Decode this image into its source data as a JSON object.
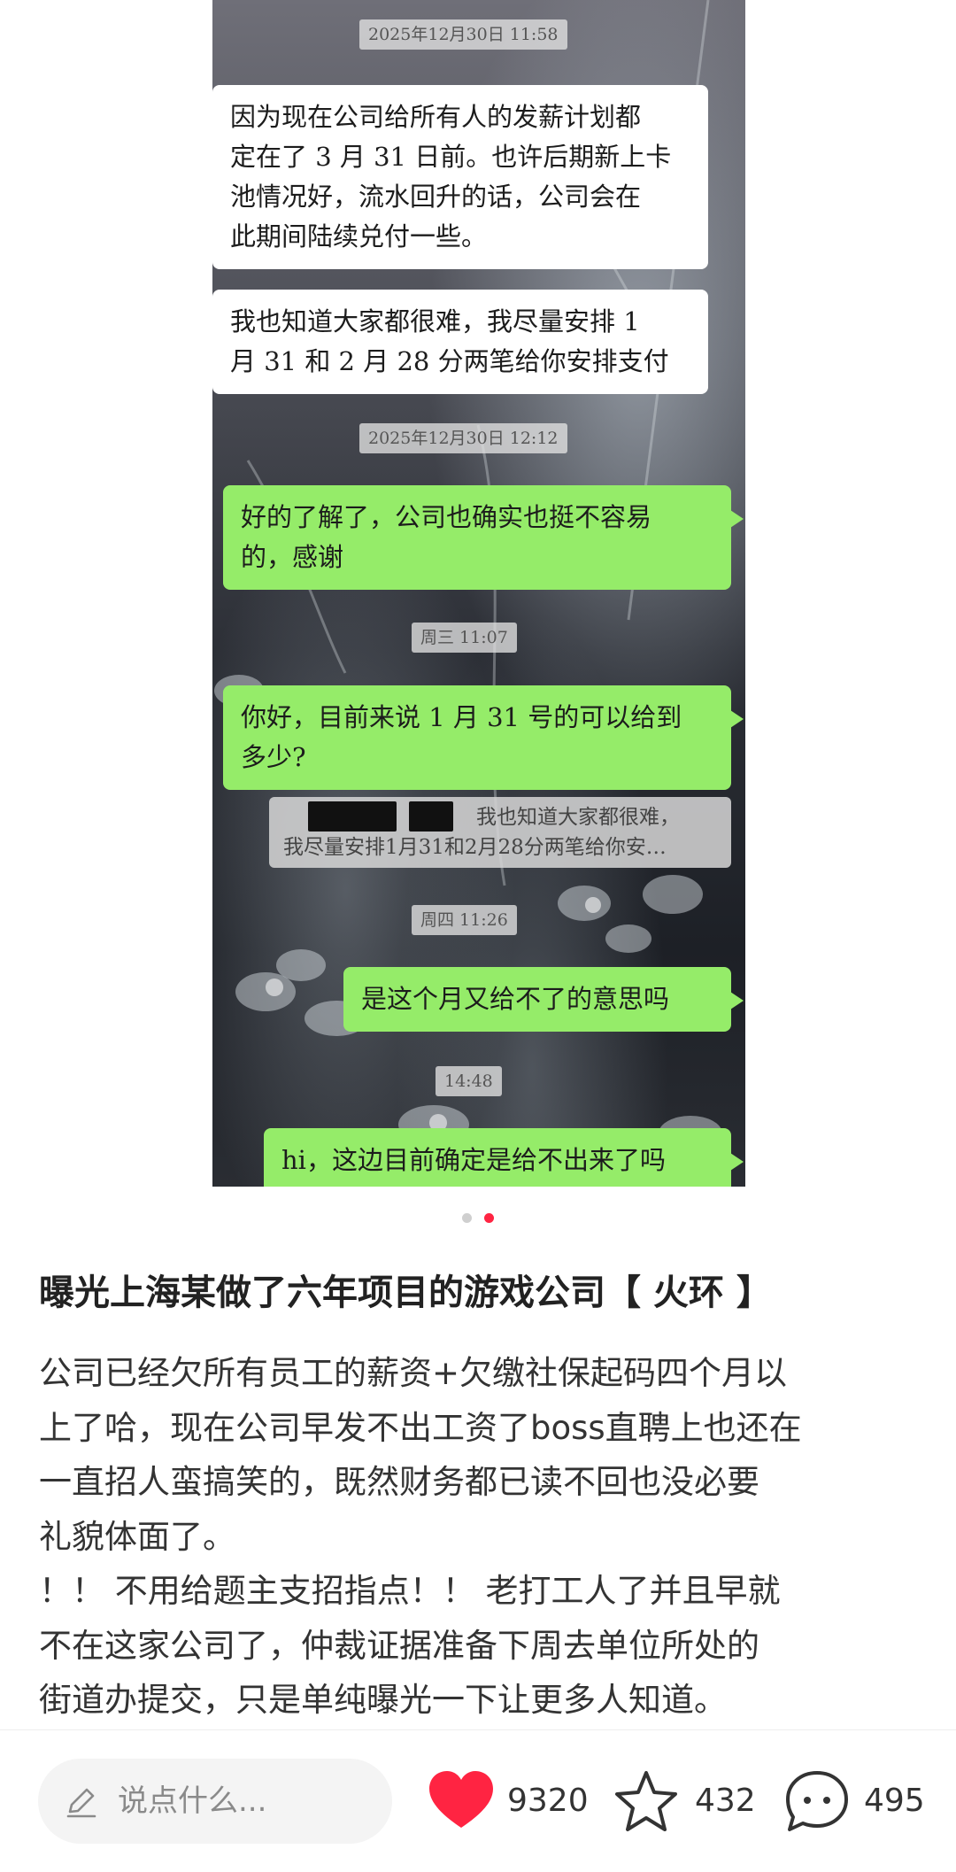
{
  "chat_screenshot": {
    "stamps": [
      "2025年12月30日 11:58",
      "2025年12月30日 12:12",
      "周三 11:07",
      "周四 11:26",
      "14:48"
    ],
    "messages": [
      {
        "side": "in",
        "lines": [
          "因为现在公司给所有人的发薪计划都",
          "定在了 3 月 31 日前。也许后期新上卡",
          "池情况好，流水回升的话，公司会在",
          "此期间陆续兑付一些。"
        ]
      },
      {
        "side": "in",
        "lines": [
          "我也知道大家都很难，我尽量安排 1",
          "月 31 和 2 月 28 分两笔给你安排支付"
        ]
      },
      {
        "side": "out",
        "lines": [
          "好的了解了，公司也确实也挺不容易",
          "的，感谢"
        ]
      },
      {
        "side": "out",
        "lines": [
          "你好，目前来说 1 月 31 号的可以给到",
          "多少?"
        ]
      },
      {
        "side": "out",
        "lines": [
          "是这个月又给不了的意思吗"
        ]
      },
      {
        "side": "in",
        "lines": [
          "hi，这边目前确定是给不出来了吗"
        ]
      }
    ],
    "quote": {
      "lines": [
        "我也知道大家都很难，",
        "我尽量安排1月31和2月28分两笔给你安…"
      ]
    }
  },
  "carousel": {
    "count": 2,
    "active_index": 1
  },
  "post": {
    "title": "曝光上海某做了六年项目的游戏公司【 火环 】",
    "content_lines": [
      "公司已经欠所有员工的薪资+欠缴社保起码四个月以",
      "上了哈，现在公司早发不出工资了boss直聘上也还在",
      "一直招人蛮搞笑的，既然财务都已读不回也没必要",
      "礼貌体面了。",
      "！！ 不用给题主支招指点！！ 老打工人了并且早就",
      "不在这家公司了，仲裁证据准备下周去单位所处的",
      "街道办提交，只是单纯曝光一下让更多人知道。"
    ]
  },
  "bottom_bar": {
    "comment_placeholder": "说点什么...",
    "likes": "9320",
    "favorites": "432",
    "comments": "495",
    "icons": {
      "comment_input": "pencil-icon",
      "likes": "heart-icon",
      "favorites": "star-icon",
      "comments": "chat-bubble-icon"
    },
    "colors": {
      "like": "#ff2442"
    }
  }
}
